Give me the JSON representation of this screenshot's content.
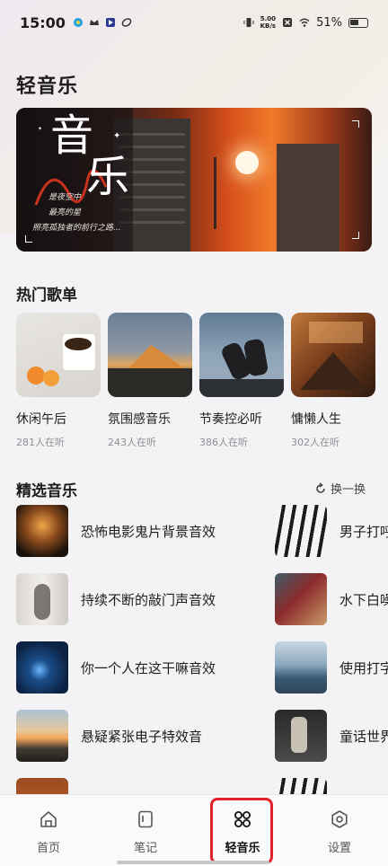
{
  "status_bar": {
    "time": "15:00",
    "net_speed_top": "5.00",
    "net_speed_bottom": "KB/s",
    "battery": "51%"
  },
  "page_title": "轻音乐",
  "banner": {
    "headline_1": "音",
    "headline_2": "乐",
    "sub_1": "是夜空中",
    "sub_2": "最亮的星",
    "sub_3": "照亮孤独者的前行之路..."
  },
  "hot_playlists": {
    "title": "热门歌单",
    "items": [
      {
        "name": "休闲午后",
        "count": "281人在听"
      },
      {
        "name": "氛围感音乐",
        "count": "243人在听"
      },
      {
        "name": "节奏控必听",
        "count": "386人在听"
      },
      {
        "name": "慵懒人生",
        "count": "302人在听"
      }
    ]
  },
  "selected_music": {
    "title": "精选音乐",
    "refresh_label": "换一换",
    "left": [
      {
        "title": "恐怖电影鬼片背景音效"
      },
      {
        "title": "持续不断的敲门声音效"
      },
      {
        "title": "你一个人在这干嘛音效"
      },
      {
        "title": "悬疑紧张电子特效音"
      }
    ],
    "right": [
      {
        "title": "男子打呼"
      },
      {
        "title": "水下白噪"
      },
      {
        "title": "使用打字"
      },
      {
        "title": "童话世界"
      }
    ]
  },
  "bottom_nav": {
    "items": [
      {
        "label": "首页",
        "icon": "home-icon"
      },
      {
        "label": "笔记",
        "icon": "notebook-icon"
      },
      {
        "label": "轻音乐",
        "icon": "music-grid-icon"
      },
      {
        "label": "设置",
        "icon": "settings-icon"
      }
    ],
    "active_index": 2,
    "highlight_color": "#e0242a"
  }
}
